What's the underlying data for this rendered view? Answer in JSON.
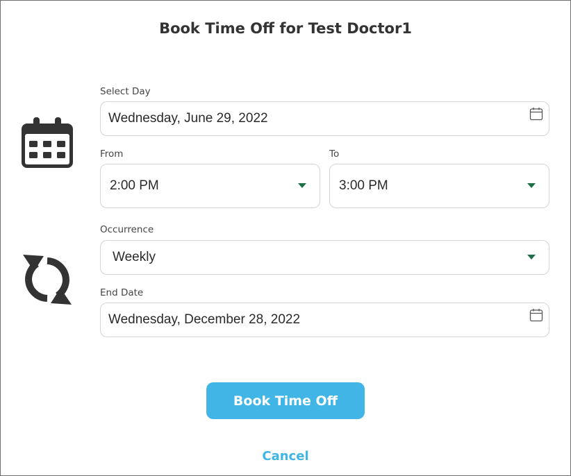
{
  "dialog": {
    "title": "Book Time Off for Test Doctor1"
  },
  "icons": {
    "schedule": "calendar-icon",
    "recurrence": "repeat-icon",
    "date_picker": "calendar-small-icon",
    "dropdown": "caret-down-icon"
  },
  "form": {
    "select_day": {
      "label": "Select Day",
      "value": "Wednesday, June 29, 2022"
    },
    "from": {
      "label": "From",
      "value": "2:00 PM"
    },
    "to": {
      "label": "To",
      "value": "3:00 PM"
    },
    "occurrence": {
      "label": "Occurrence",
      "value": "Weekly"
    },
    "end_date": {
      "label": "End Date",
      "value": "Wednesday, December 28, 2022"
    }
  },
  "actions": {
    "book_label": "Book Time Off",
    "cancel_label": "Cancel"
  },
  "colors": {
    "accent": "#41b6e6",
    "caret": "#1e6e47",
    "icon": "#333333",
    "border": "#d4d4d4"
  }
}
